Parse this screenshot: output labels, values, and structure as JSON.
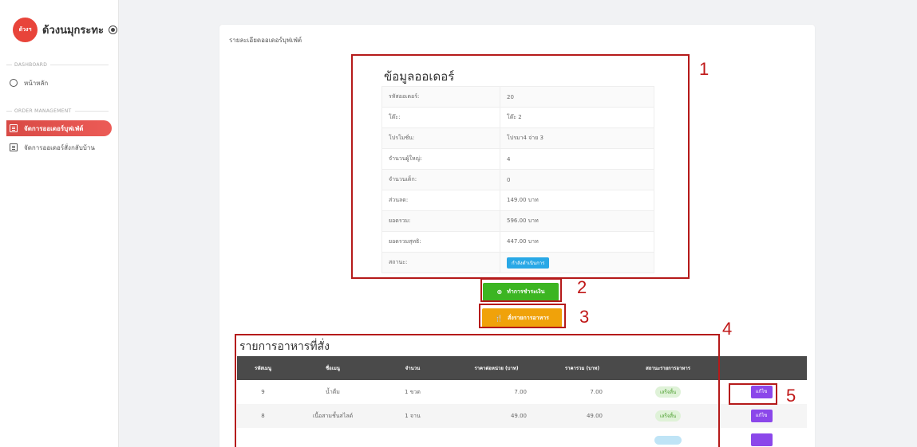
{
  "sidebar": {
    "logo_text": "ด้วงฯ",
    "brand": "ด้วงนมุกระทะ",
    "sections": [
      {
        "label": "DASHBOARD"
      },
      {
        "label": "ORDER MANAGEMENT"
      }
    ],
    "items": [
      {
        "label": "หน้าหลัก"
      },
      {
        "label": "จัดการออเดอร์บุฟเฟ่ต์"
      },
      {
        "label": "จัดการออเดอร์สั่งกลับบ้าน"
      }
    ]
  },
  "card": {
    "title": "รายละเอียดออเดอร์บุฟเฟ่ต์"
  },
  "order_info": {
    "title": "ข้อมูลออเดอร์",
    "rows": [
      {
        "label": "รหัสออเดอร์:",
        "value": "20"
      },
      {
        "label": "โต๊ะ:",
        "value": "โต๊ะ 2"
      },
      {
        "label": "โปรโมชั่น:",
        "value": "โปรมา4 จ่าย 3"
      },
      {
        "label": "จำนวนผู้ใหญ่:",
        "value": "4"
      },
      {
        "label": "จำนวนเด็ก:",
        "value": "0"
      },
      {
        "label": "ส่วนลด:",
        "value": "149.00 บาท"
      },
      {
        "label": "ยอดรวม:",
        "value": "596.00 บาท"
      },
      {
        "label": "ยอดรวมสุทธิ:",
        "value": "447.00 บาท"
      },
      {
        "label": "สถานะ:",
        "value": "กำลังดำเนินการ"
      }
    ]
  },
  "buttons": {
    "pay": "ทำการชำระเงิน",
    "order_food": "สั่งรายการอาหาร"
  },
  "items_list": {
    "title": "รายการอาหารที่สั่ง",
    "headers": [
      "รหัสเมนู",
      "ชื่อเมนู",
      "จำนวน",
      "ราคาต่อหน่วย (บาท)",
      "ราคารวม (บาท)",
      "สถานะรายการอาหาร",
      ""
    ],
    "rows": [
      {
        "id": "9",
        "name": "น้ำดื่ม",
        "qty": "1 ขวด",
        "unit_price": "7.00",
        "total": "7.00",
        "status": "เสร็จสิ้น",
        "action": "แก้ไข"
      },
      {
        "id": "8",
        "name": "เนื้อสามชั้นสไลด์",
        "qty": "1 จาน",
        "unit_price": "49.00",
        "total": "49.00",
        "status": "เสร็จสิ้น",
        "action": "แก้ไข"
      }
    ]
  },
  "annotations": [
    "1",
    "2",
    "3",
    "4",
    "5"
  ],
  "colors": {
    "accent_red": "#e04f4a",
    "annotation": "#b51a1a",
    "pay_green": "#3cb522",
    "order_orange": "#f0a20a",
    "status_blue": "#29a8e6",
    "edit_purple": "#8b47ea"
  }
}
